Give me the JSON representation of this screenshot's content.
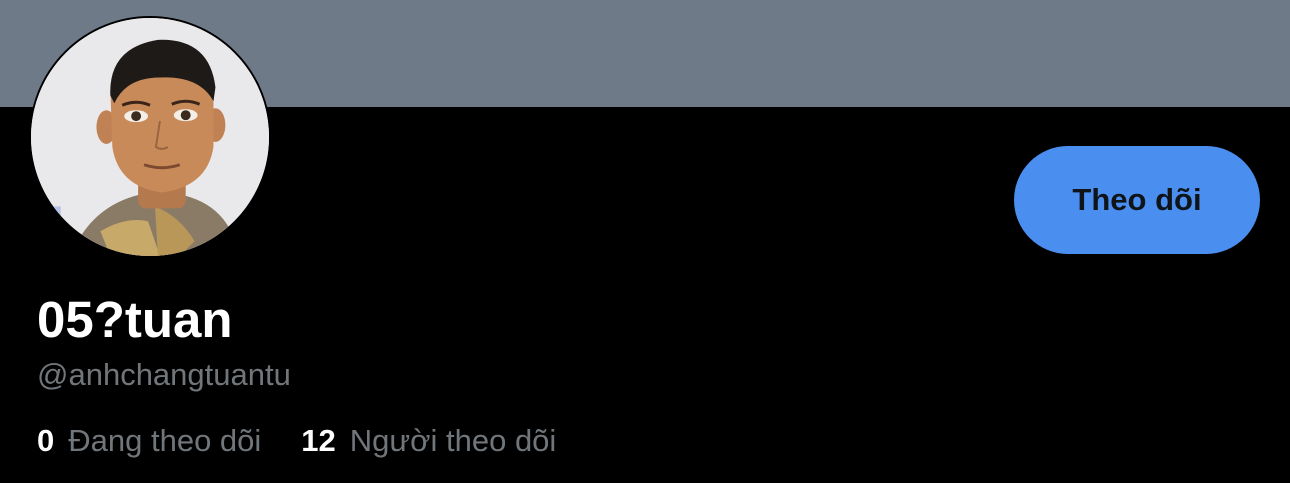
{
  "colors": {
    "background": "#000000",
    "banner": "#6e7a87",
    "accent": "#4a8ef0",
    "button_text": "#0f1419",
    "muted_text": "#71767b",
    "primary_text": "#ffffff"
  },
  "profile": {
    "display_name": "05?tuan",
    "handle": "@anhchangtuantu",
    "avatar": "profile-photo"
  },
  "actions": {
    "follow_label": "Theo dõi"
  },
  "stats": {
    "following": {
      "count": "0",
      "label": "Đang theo dõi"
    },
    "followers": {
      "count": "12",
      "label": "Người theo dõi"
    }
  }
}
